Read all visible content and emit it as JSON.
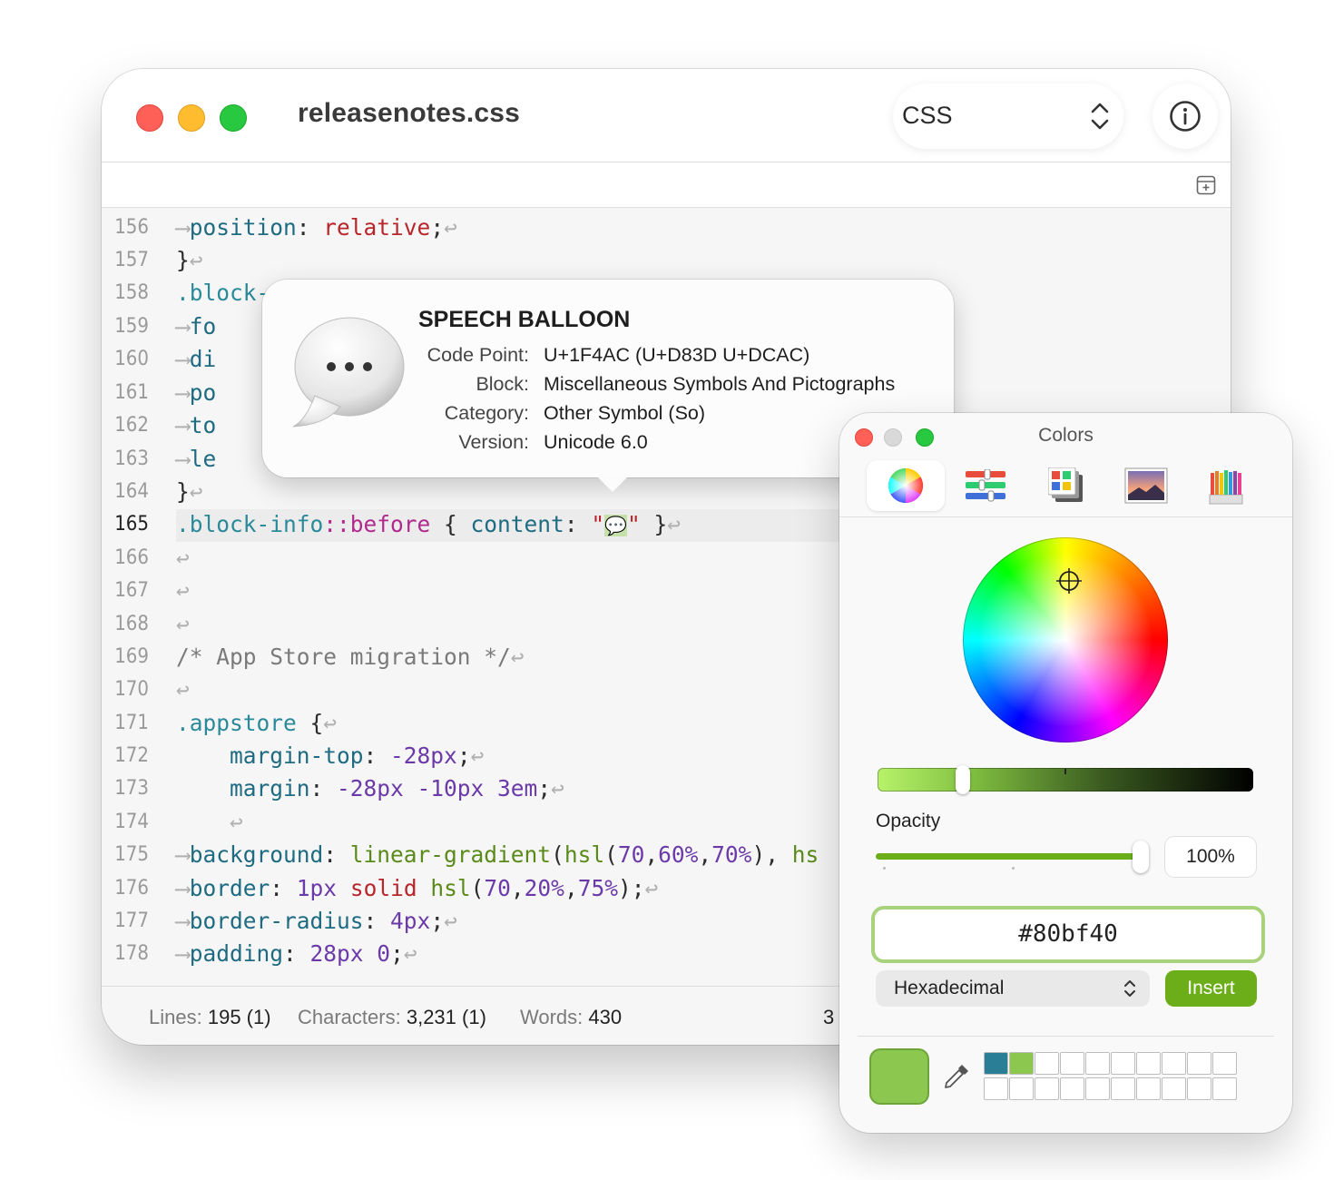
{
  "editor": {
    "title": "releasenotes.css",
    "syntax": "CSS",
    "current_line": "165"
  },
  "code_lines": [
    {
      "n": "156"
    },
    {
      "n": "157"
    },
    {
      "n": "158"
    },
    {
      "n": "159"
    },
    {
      "n": "160"
    },
    {
      "n": "161"
    },
    {
      "n": "162"
    },
    {
      "n": "163"
    },
    {
      "n": "164"
    },
    {
      "n": "165"
    },
    {
      "n": "166"
    },
    {
      "n": "167"
    },
    {
      "n": "168"
    },
    {
      "n": "169"
    },
    {
      "n": "170"
    },
    {
      "n": "171"
    },
    {
      "n": "172"
    },
    {
      "n": "173"
    },
    {
      "n": "174"
    },
    {
      "n": "175"
    },
    {
      "n": "176"
    },
    {
      "n": "177"
    },
    {
      "n": "178"
    }
  ],
  "status": {
    "lines_label": "Lines:",
    "lines_value": "195 (1)",
    "chars_label": "Characters:",
    "chars_value": "3,231 (1)",
    "words_label": "Words:",
    "words_value": "430",
    "cursor_partial": "3"
  },
  "char_info": {
    "glyph": "💬",
    "name": "SPEECH BALLOON",
    "code_point_label": "Code Point:",
    "code_point": "U+1F4AC (U+D83D U+DCAC)",
    "block_label": "Block:",
    "block": "Miscellaneous Symbols And Pictographs",
    "category_label": "Category:",
    "category": "Other Symbol (So)",
    "version_label": "Version:",
    "version": "Unicode 6.0"
  },
  "colors_panel": {
    "title": "Colors",
    "tabs": [
      "color-wheel",
      "color-sliders",
      "color-palettes",
      "image-palettes",
      "pencils"
    ],
    "opacity_label": "Opacity",
    "opacity_value": "100%",
    "hex_value": "#80bf40",
    "format": "Hexadecimal",
    "insert_label": "Insert",
    "current_color": "#8cc750",
    "saved_swatches": [
      "#2a7f96",
      "#8cc750"
    ],
    "accent": "#6cae1a"
  }
}
